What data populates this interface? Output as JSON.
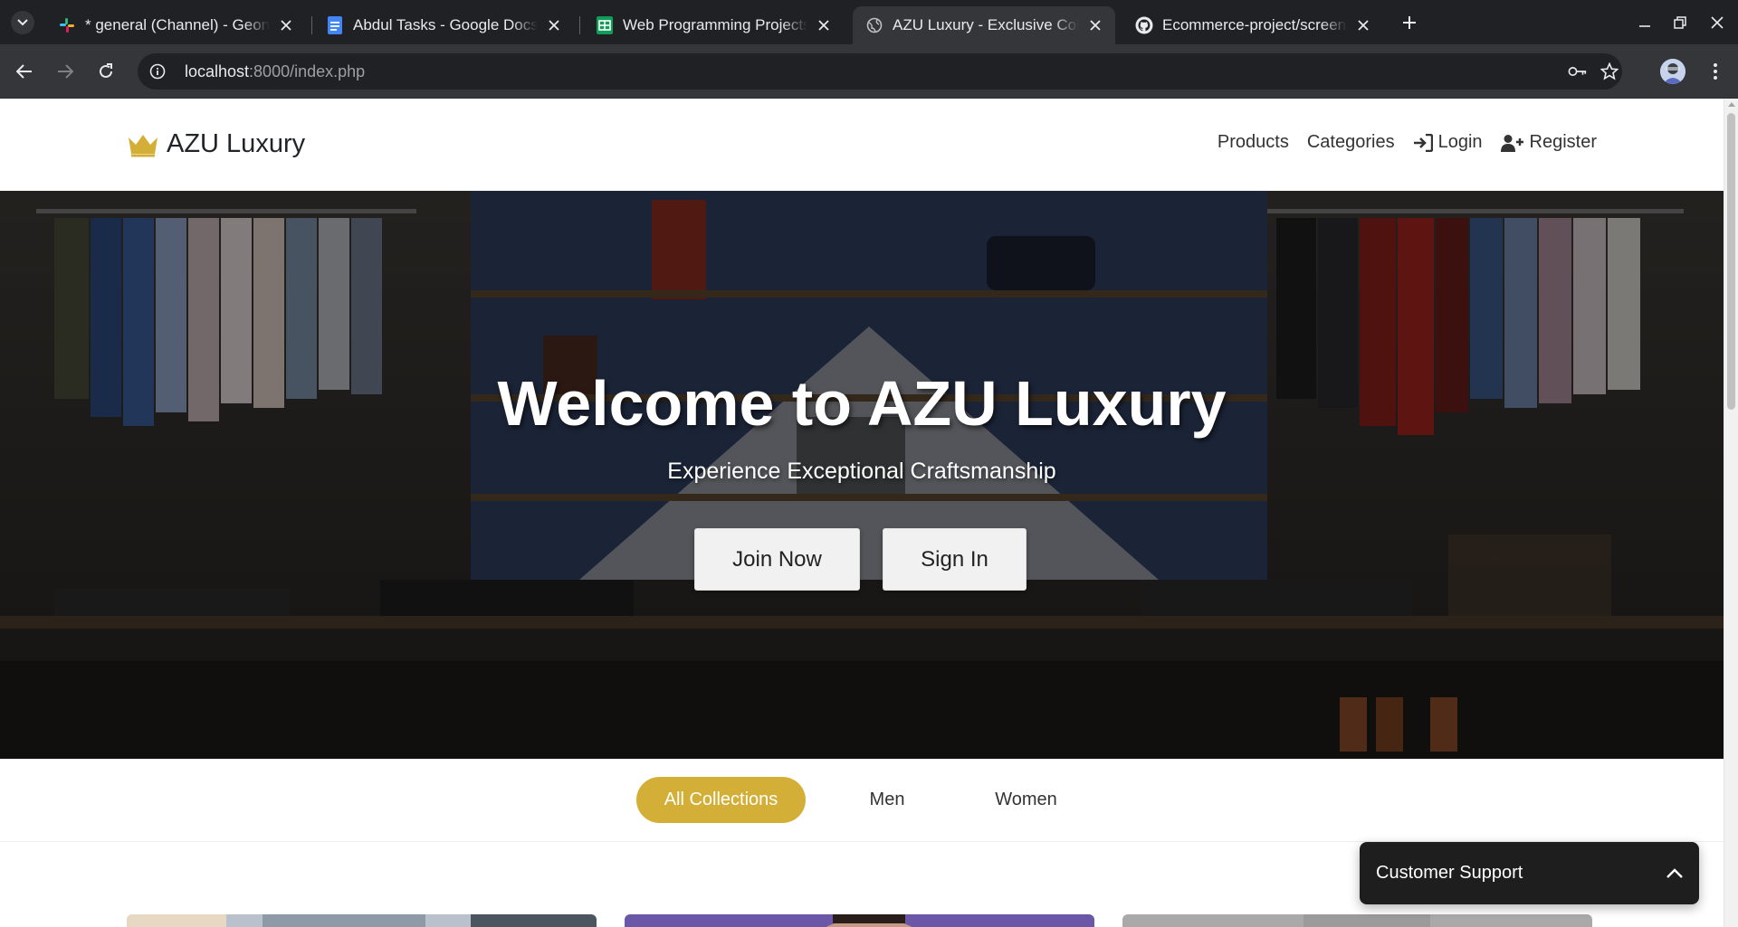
{
  "browser": {
    "tabs": [
      {
        "title": "* general (Channel) - Geonc",
        "favicon": "slack-icon",
        "active": false
      },
      {
        "title": "Abdul Tasks - Google Docs",
        "favicon": "docs-icon",
        "active": false
      },
      {
        "title": "Web Programming Projects",
        "favicon": "sheets-icon",
        "active": false
      },
      {
        "title": "AZU Luxury - Exclusive Colle",
        "favicon": "globe-icon",
        "active": true
      },
      {
        "title": "Ecommerce-project/screens",
        "favicon": "github-icon",
        "active": false
      }
    ],
    "url_host": "localhost",
    "url_path": ":8000/index.php"
  },
  "site": {
    "brand": "AZU Luxury",
    "nav": {
      "products": "Products",
      "categories": "Categories",
      "login": "Login",
      "register": "Register"
    },
    "hero": {
      "title": "Welcome to AZU Luxury",
      "subtitle": "Experience Exceptional Craftsmanship",
      "join": "Join Now",
      "signin": "Sign In"
    },
    "filters": {
      "all": "All Collections",
      "men": "Men",
      "women": "Women"
    },
    "support": "Customer Support"
  },
  "colors": {
    "accent_gold": "#d4af37",
    "chrome_dark": "#202124",
    "chrome_mid": "#35363a",
    "support_bg": "#1e1e1e"
  }
}
